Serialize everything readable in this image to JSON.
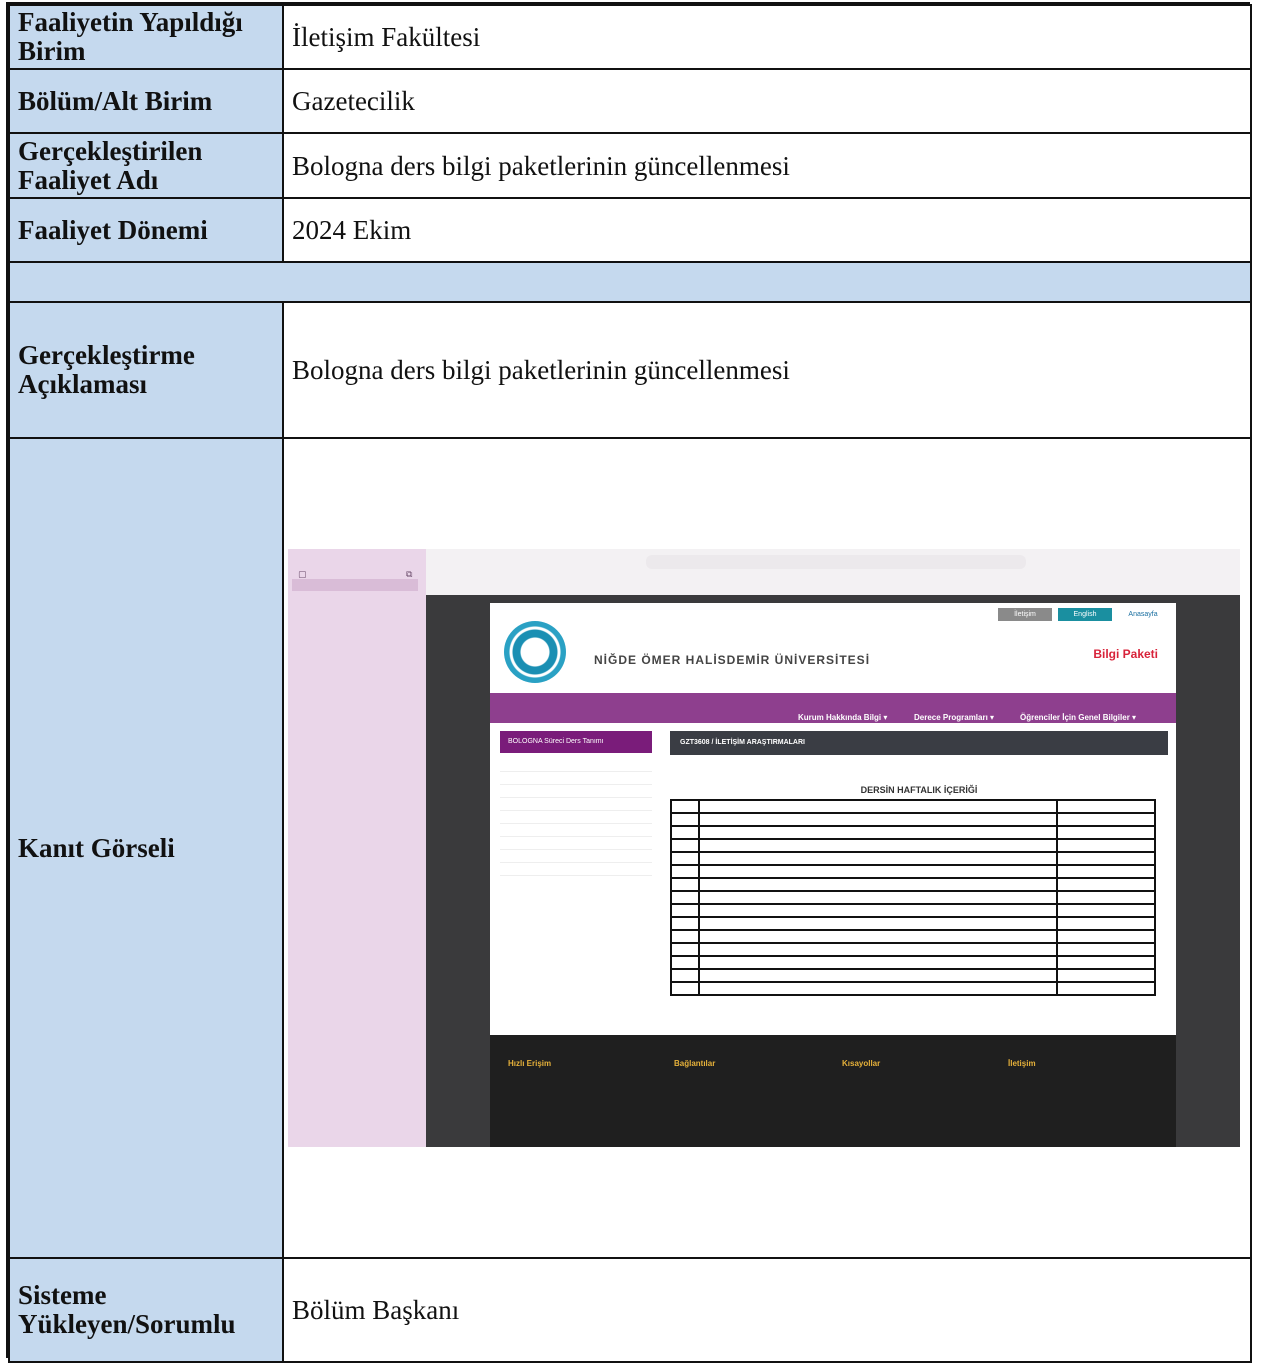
{
  "rows": {
    "unit_label": "Faaliyetin Yapıldığı Birim",
    "unit_value": "İletişim Fakültesi",
    "dept_label": "Bölüm/Alt Birim",
    "dept_value": "Gazetecilik",
    "activity_label": "Gerçekleştirilen Faaliyet Adı",
    "activity_value": "Bologna ders bilgi paketlerinin güncellenmesi",
    "period_label": "Faaliyet Dönemi",
    "period_value": "2024 Ekim",
    "desc_label": "Gerçekleştirme Açıklaması",
    "desc_value": "Bologna ders bilgi paketlerinin güncellenmesi",
    "evidence_label": "Kanıt Görseli",
    "responsible_label": "Sisteme Yükleyen/Sorumlu",
    "responsible_value": "Bölüm Başkanı"
  },
  "screenshot": {
    "university": "NİĞDE ÖMER HALİSDEMİR ÜNİVERSİTESİ",
    "bilgi_paketi": "Bilgi Paketi",
    "top_buttons": [
      "İletişim",
      "English",
      "Anasayfa"
    ],
    "nav": [
      "Kurum Hakkında Bilgi ▾",
      "Derece Programları ▾",
      "Öğrenciler İçin Genel Bilgiler ▾"
    ],
    "left_button": "BOLOGNA Süreci Ders Tanımı",
    "course_title": "GZT3608 / İLETİŞİM ARAŞTIRMALARI",
    "weekly_title": "DERSİN HAFTALIK İÇERİĞİ",
    "footer_heads": [
      "Hızlı Erişim",
      "Bağlantılar",
      "Kısayollar",
      "İletişim"
    ]
  }
}
